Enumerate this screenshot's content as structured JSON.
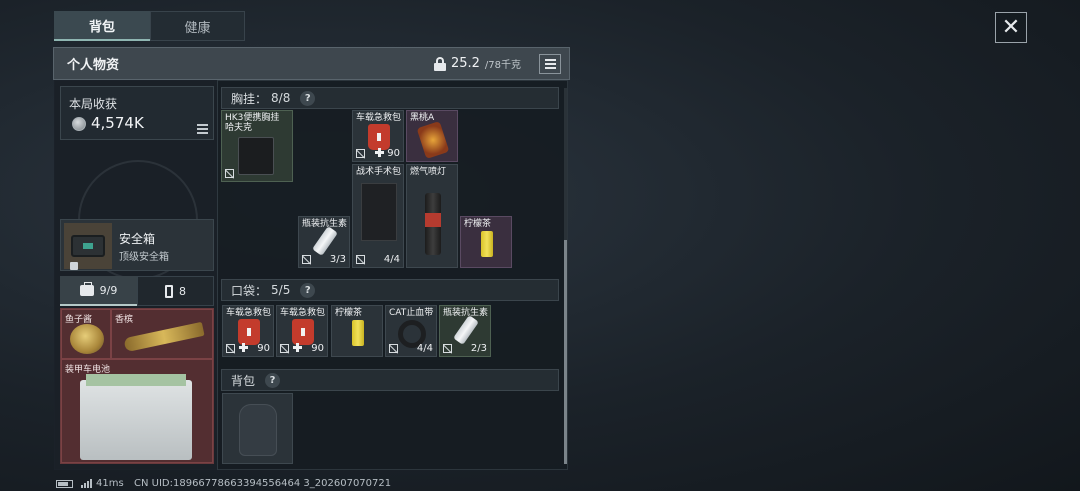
{
  "tabs": {
    "backpack": "背包",
    "health": "健康"
  },
  "close_glyph": "✕",
  "header": {
    "title": "个人物资",
    "weight_current": "25.2",
    "weight_max": "/78千克"
  },
  "left": {
    "harvest_label": "本局收获",
    "harvest_value": "4,574K",
    "safebox_name": "安全箱",
    "safebox_sub": "顶级安全箱",
    "subtab_1_count": "9/9",
    "subtab_2_count": "8",
    "items": [
      "鱼子酱",
      "香槟",
      "装甲车电池"
    ]
  },
  "sections": {
    "chest": {
      "label": "胸挂：",
      "count": "8/8",
      "q": "?"
    },
    "pocket": {
      "label": "口袋：",
      "count": "5/5",
      "q": "?"
    },
    "backpack": {
      "label": "背包",
      "q": "?"
    }
  },
  "chest_items": {
    "rig": "HK3便携胸挂\n哈夫克",
    "aid_pack": "车载急救包",
    "aid_pack_count": "90",
    "black_card": "黑桃A",
    "tac_bag": "战术手术包",
    "tac_bag_count": "4/4",
    "torch": "燃气喷灯",
    "antibiotic": "瓶装抗生素",
    "antibiotic_count": "3/3",
    "lemon_tea": "柠檬茶"
  },
  "pocket_items": [
    {
      "name": "车载急救包",
      "count": "90"
    },
    {
      "name": "车载急救包",
      "count": "90"
    },
    {
      "name": "柠檬茶",
      "count": ""
    },
    {
      "name": "CAT止血带",
      "count": "4/4"
    },
    {
      "name": "瓶装抗生素",
      "count": "2/3"
    }
  ],
  "footer": {
    "ping": "41ms",
    "uid": "CN UID:18966778663394556464 3_202607070721"
  },
  "colors": {
    "accent": "#8fb6b2",
    "red_grid": "#4a2a2d",
    "green_slot": "#2e3a33",
    "purple_slot": "#3a2f3f"
  }
}
